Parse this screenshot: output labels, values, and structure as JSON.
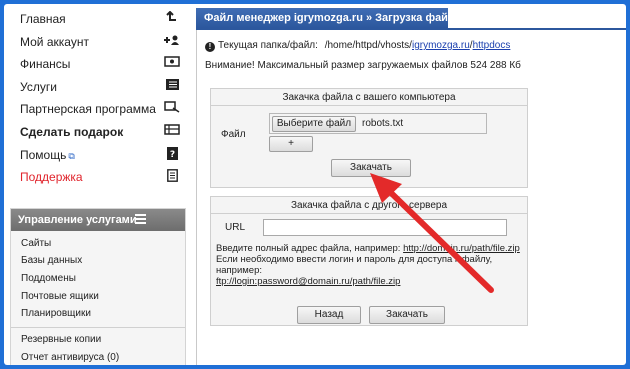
{
  "sidebar": {
    "items": [
      {
        "label": "Главная",
        "icon": "return-arrow-icon"
      },
      {
        "label": "Мой аккаунт",
        "icon": "add-user-icon"
      },
      {
        "label": "Финансы",
        "icon": "money-icon"
      },
      {
        "label": "Услуги",
        "icon": "list-icon"
      },
      {
        "label": "Партнерская программа",
        "icon": "partners-icon"
      },
      {
        "label": "Сделать подарок",
        "icon": "gift-icon"
      },
      {
        "label": "Помощь",
        "icon": "help-icon"
      },
      {
        "label": "Поддержка",
        "icon": "document-icon"
      }
    ],
    "services_title": "Управление услугами",
    "services": [
      "Сайты",
      "Базы данных",
      "Поддомены",
      "Почтовые ящики",
      "Планировщики",
      "Резервные копии",
      "Отчет антивируса (0)"
    ]
  },
  "main": {
    "header": "Файл менеджер igrymozga.ru » Загрузка файлов",
    "folder_label": "Текущая папка/файл:",
    "folder_path_prefix": "/home/httpd/vhosts/",
    "folder_path_domain": "igrymozga.ru",
    "folder_path_sep": "/",
    "folder_path_dir": "httpdocs",
    "limit_notice": "Внимание! Максимальный размер загружаемых файлов 524 288 Кб",
    "upload": {
      "title": "Закачка файла с вашего компьютера",
      "file_label": "Файл",
      "choose_button": "Выберите файл",
      "chosen_file": "robots.txt",
      "add_button": "+",
      "submit_button": "Закачать"
    },
    "server": {
      "title": "Закачка файла с другого сервера",
      "url_label": "URL",
      "url_value": "",
      "hint_intro": "Введите полный адрес файла, например: ",
      "hint_example": "http://domain.ru/path/file.zip",
      "hint_auth": "Если необходимо ввести логин и пароль для доступа к файлу, например:",
      "hint_auth_example": "ftp://login:password@domain.ru/path/file.zip",
      "back_button": "Назад",
      "submit_button": "Закачать"
    }
  },
  "colors": {
    "page_frame": "#1f6fd6",
    "header_blue": "#2c579d",
    "support_red": "#e0242c",
    "arrow_red": "#e32a2a"
  }
}
